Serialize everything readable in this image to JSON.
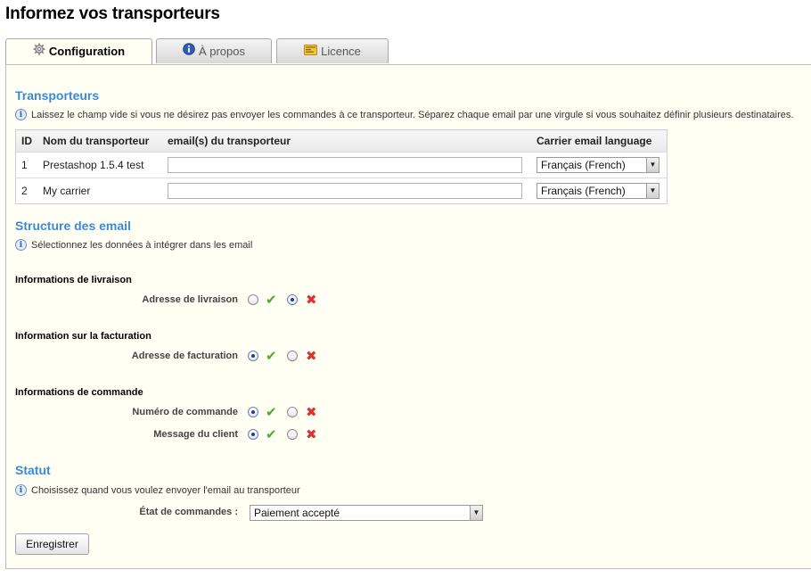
{
  "page_title": "Informez vos transporteurs",
  "tabs": [
    {
      "label": "Configuration",
      "icon": "gear-icon",
      "active": true
    },
    {
      "label": "À propos",
      "icon": "info-icon",
      "active": false
    },
    {
      "label": "Licence",
      "icon": "license-card-icon",
      "active": false
    }
  ],
  "carriers_section": {
    "title": "Transporteurs",
    "hint": "Laissez le champ vide si vous ne désirez pas envoyer les commandes à ce transporteur. Séparez chaque email par une virgule si vous souhaitez définir plusieurs destinataires.",
    "columns": [
      "ID",
      "Nom du transporteur",
      "email(s) du transporteur",
      "Carrier email language"
    ],
    "rows": [
      {
        "id": "1",
        "name": "Prestashop 1.5.4 test",
        "email": "",
        "language": "Français (French)"
      },
      {
        "id": "2",
        "name": "My carrier",
        "email": "",
        "language": "Français (French)"
      }
    ]
  },
  "email_structure": {
    "title": "Structure des email",
    "hint": "Sélectionnez les données à intégrer dans les email",
    "groups": [
      {
        "title": "Informations de livraison",
        "fields": [
          {
            "label": "Adresse de livraison",
            "enabled": false
          }
        ]
      },
      {
        "title": "Information sur la facturation",
        "fields": [
          {
            "label": "Adresse de facturation",
            "enabled": true
          }
        ]
      },
      {
        "title": "Informations de commande",
        "fields": [
          {
            "label": "Numéro de commande",
            "enabled": true
          },
          {
            "label": "Message du client",
            "enabled": true
          }
        ]
      }
    ]
  },
  "status_section": {
    "title": "Statut",
    "hint": "Choisissez quand vous voulez envoyer l'email au transporteur",
    "order_state_label": "État de commandes :",
    "order_state_value": "Paiement accepté"
  },
  "save_button": "Enregistrer",
  "colors": {
    "section_title": "#3b8ad6",
    "check": "#4caa2a",
    "cross": "#d83434",
    "panel_bg": "#fffff4"
  }
}
